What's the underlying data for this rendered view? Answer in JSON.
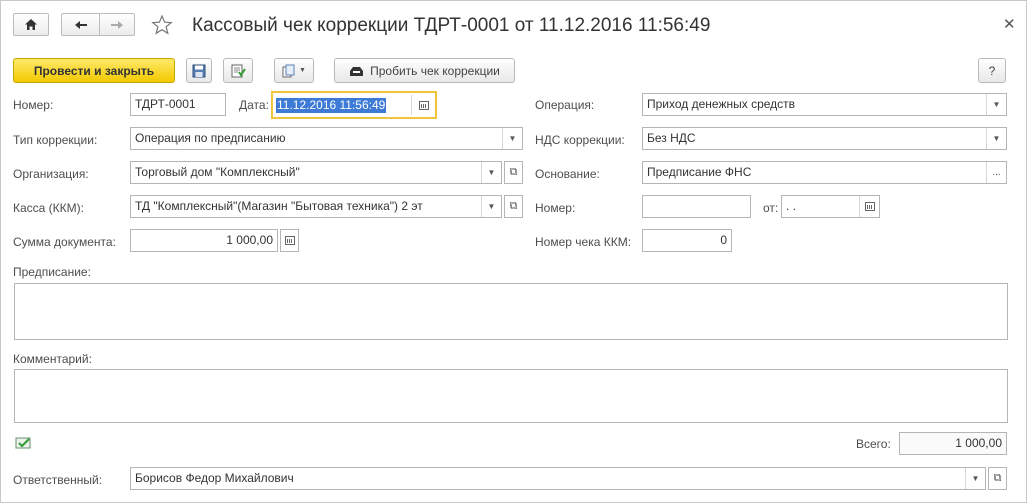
{
  "title": "Кассовый чек коррекции ТДРТ-0001 от 11.12.2016 11:56:49",
  "toolbar": {
    "post_close": "Провести и закрыть",
    "print_correction": "Пробить чек коррекции",
    "help": "?"
  },
  "form": {
    "number_label": "Номер:",
    "number_value": "ТДРТ-0001",
    "date_label": "Дата:",
    "date_value": "11.12.2016 11:56:49",
    "correction_type_label": "Тип коррекции:",
    "correction_type_value": "Операция по предписанию",
    "org_label": "Организация:",
    "org_value": "Торговый дом \"Комплексный\"",
    "kassa_label": "Касса (ККМ):",
    "kassa_value": "ТД \"Комплексный\"(Магазин \"Бытовая техника\") 2 эт",
    "sum_label": "Сумма документа:",
    "sum_value": "1 000,00",
    "operation_label": "Операция:",
    "operation_value": "Приход денежных средств",
    "vat_label": "НДС коррекции:",
    "vat_value": "Без НДС",
    "basis_label": "Основание:",
    "basis_value": "Предписание ФНС",
    "basis_number_label": "Номер:",
    "basis_number_value": "",
    "from_label": "от:",
    "from_value": " .  .",
    "kkm_check_label": "Номер чека ККМ:",
    "kkm_check_value": "0",
    "prescription_label": "Предписание:",
    "comment_label": "Комментарий:",
    "total_label": "Всего:",
    "total_value": "1 000,00",
    "responsible_label": "Ответственный:",
    "responsible_value": "Борисов Федор Михайлович"
  },
  "colors": {
    "primary_button": "#f2c900",
    "focus_border": "#f0c53b",
    "selection": "#3d7bd6"
  }
}
